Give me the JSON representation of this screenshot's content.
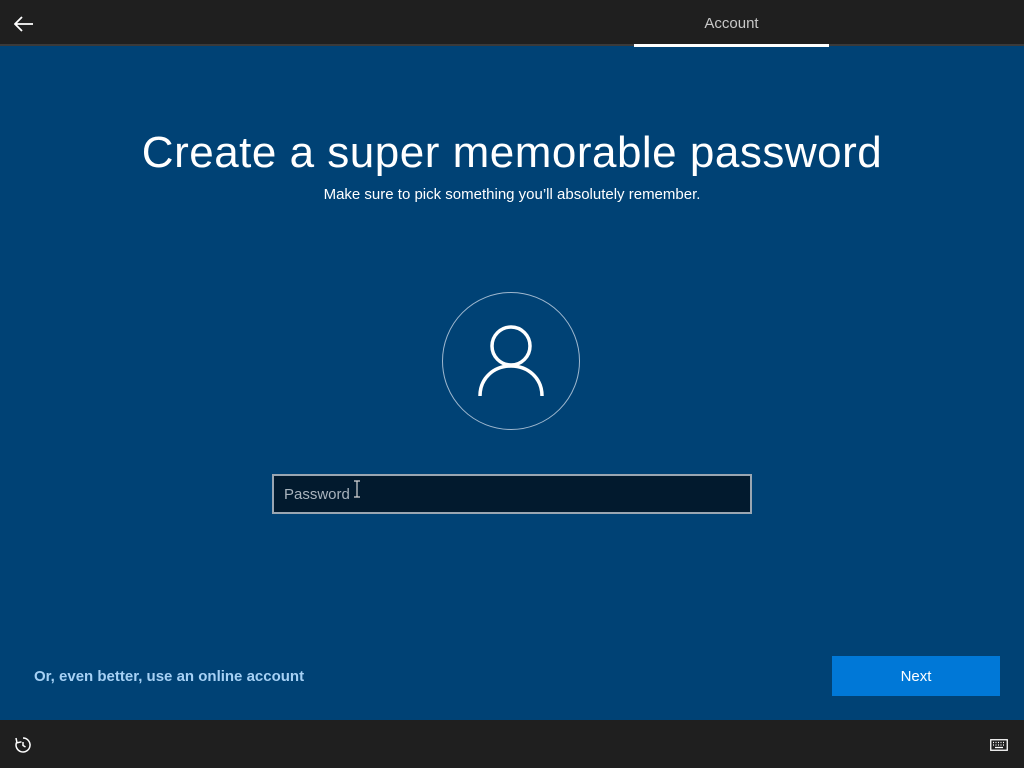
{
  "header": {
    "back_icon": "back-arrow-icon",
    "tab_label": "Account"
  },
  "main": {
    "title": "Create a super memorable password",
    "subtitle": "Make sure to pick something you’ll absolutely remember.",
    "avatar_icon": "user-icon",
    "password_field": {
      "placeholder": "Password",
      "value": ""
    },
    "online_account_link": "Or, even better, use an online account",
    "next_label": "Next"
  },
  "footer": {
    "accessibility_icon": "ease-of-access-icon",
    "keyboard_icon": "keyboard-icon"
  },
  "colors": {
    "background": "#004275",
    "bar": "#1f1f1f",
    "accent": "#0078d7",
    "link": "#a6d1f5"
  }
}
